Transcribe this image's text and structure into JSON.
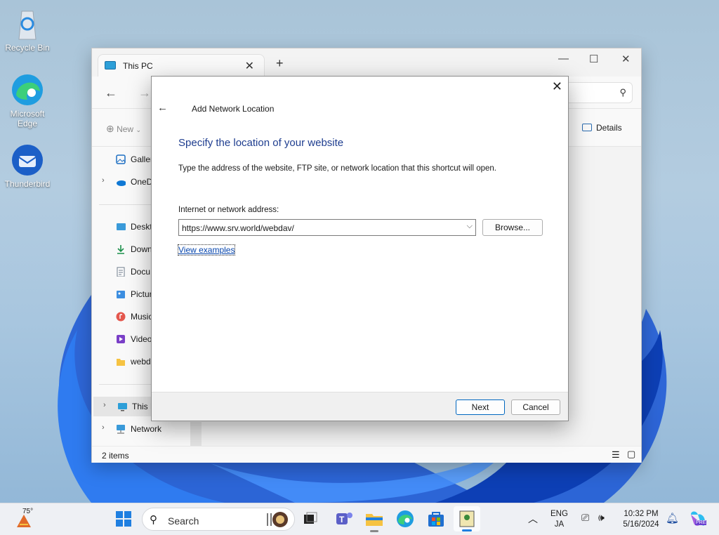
{
  "desktop": {
    "icons": [
      {
        "label": "Recycle Bin",
        "icon": "recycle-bin-icon"
      },
      {
        "label": "Microsoft Edge",
        "icon": "edge-icon"
      },
      {
        "label": "Thunderbird",
        "icon": "thunderbird-icon"
      }
    ]
  },
  "explorer": {
    "tab_title": "This PC",
    "new_label": "New",
    "details_label": "Details",
    "sidebar": [
      {
        "label": "Galler",
        "icon": "gallery-icon"
      },
      {
        "label": "OneD",
        "icon": "onedrive-icon"
      },
      {
        "label": "Deskt",
        "icon": "desktop-icon"
      },
      {
        "label": "Down",
        "icon": "downloads-icon"
      },
      {
        "label": "Docu",
        "icon": "documents-icon"
      },
      {
        "label": "Pictur",
        "icon": "pictures-icon"
      },
      {
        "label": "Music",
        "icon": "music-icon"
      },
      {
        "label": "Video",
        "icon": "videos-icon"
      },
      {
        "label": "webda",
        "icon": "folder-icon"
      },
      {
        "label": "This P",
        "icon": "this-pc-icon"
      },
      {
        "label": "Network",
        "icon": "network-icon"
      }
    ],
    "status": "2 items"
  },
  "dialog": {
    "title": "Add Network Location",
    "heading": "Specify the location of your website",
    "description": "Type the address of the website, FTP site, or network location that this shortcut will open.",
    "address_label": "Internet or network address:",
    "address_value": "https://www.srv.world/webdav/",
    "browse_label": "Browse...",
    "view_examples": "View examples",
    "next_label": "Next",
    "cancel_label": "Cancel"
  },
  "taskbar": {
    "weather_temp": "75°",
    "search_placeholder": "Search",
    "language_top": "ENG",
    "language_bottom": "JA",
    "time": "10:32 PM",
    "date": "5/16/2024",
    "copilot_badge": "PRE"
  },
  "colors": {
    "accent": "#0067c0",
    "heading": "#1e3d8f",
    "link": "#0645ad"
  }
}
